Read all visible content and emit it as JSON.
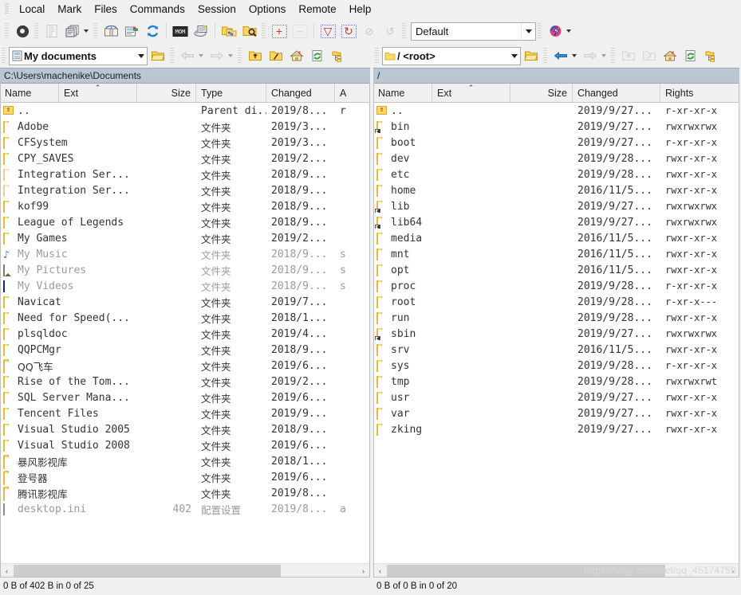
{
  "menu": {
    "items": [
      "Local",
      "Mark",
      "Files",
      "Commands",
      "Session",
      "Options",
      "Remote",
      "Help"
    ]
  },
  "toolbar": {
    "buttons": [
      {
        "name": "preferences",
        "icon": "gear-icon",
        "enabled": true
      },
      {
        "name": "session-properties",
        "icon": "document-properties-icon",
        "enabled": false
      },
      {
        "name": "duplicate-session",
        "icon": "copy-windows-icon",
        "enabled": true
      },
      {
        "name": "open-session",
        "icon": "open-session-icon",
        "enabled": true
      },
      {
        "name": "new-session",
        "icon": "new-session-icon",
        "enabled": true
      },
      {
        "name": "synchronize",
        "icon": "refresh-sync-icon",
        "enabled": true
      },
      {
        "name": "console",
        "icon": "console-icon",
        "enabled": true
      },
      {
        "name": "keep-remote-up-to-date",
        "icon": "keep-up-to-date-icon",
        "enabled": true
      },
      {
        "name": "synchronize-browsing",
        "icon": "sync-folders-icon",
        "enabled": true
      },
      {
        "name": "find-files",
        "icon": "find-files-icon",
        "enabled": true
      },
      {
        "name": "queue-add",
        "icon": "plus-icon",
        "enabled": true
      },
      {
        "name": "queue-remove",
        "icon": "minus-icon",
        "enabled": false
      },
      {
        "name": "filter",
        "icon": "funnel-icon",
        "enabled": true
      },
      {
        "name": "refresh",
        "icon": "refresh-icon",
        "enabled": true
      },
      {
        "name": "stop",
        "icon": "no-entry-icon",
        "enabled": false
      },
      {
        "name": "reconnect",
        "icon": "reload-circle-icon",
        "enabled": false
      }
    ],
    "preset": {
      "label": "Default",
      "name": "color-preset-combo"
    },
    "session_icon": {
      "name": "winscp-session-icon"
    }
  },
  "left_pane": {
    "nav": {
      "drive_label": "My documents",
      "drive_icon": "my-documents-icon",
      "open_dir_icon": "open-folder-icon",
      "back_enabled": false,
      "forward_enabled": false,
      "parent_icon": "parent-directory-icon",
      "root_icon": "root-directory-icon",
      "home_icon": "home-icon",
      "refresh_icon": "refresh-icon",
      "tree_icon": "directory-tree-icon"
    },
    "path": "C:\\Users\\machenike\\Documents",
    "columns": [
      {
        "label": "Name",
        "width": 74,
        "align": "left",
        "sorted": false
      },
      {
        "label": "Ext",
        "width": 98,
        "align": "left",
        "sorted": true
      },
      {
        "label": "Size",
        "width": 74,
        "align": "right",
        "sorted": false
      },
      {
        "label": "Type",
        "width": 88,
        "align": "left",
        "sorted": false
      },
      {
        "label": "Changed",
        "width": 86,
        "align": "left",
        "sorted": false
      },
      {
        "label": "A",
        "width": 40,
        "align": "left",
        "sorted": false
      }
    ],
    "rows": [
      {
        "icon": "parent-directory-icon",
        "name": "..",
        "ext": "",
        "size": "",
        "type": "Parent di...",
        "changed": "2019/8...",
        "attr": "r"
      },
      {
        "icon": "folder-icon",
        "name": "Adobe",
        "ext": "",
        "size": "",
        "type": "文件夹",
        "changed": "2019/3...",
        "attr": ""
      },
      {
        "icon": "folder-icon",
        "name": "CFSystem",
        "ext": "",
        "size": "",
        "type": "文件夹",
        "changed": "2019/3...",
        "attr": ""
      },
      {
        "icon": "folder-icon",
        "name": "CPY_SAVES",
        "ext": "",
        "size": "",
        "type": "文件夹",
        "changed": "2019/2...",
        "attr": ""
      },
      {
        "icon": "folder-icon-pale",
        "name": "Integration Ser...",
        "ext": "",
        "size": "",
        "type": "文件夹",
        "changed": "2018/9...",
        "attr": ""
      },
      {
        "icon": "folder-icon-pale",
        "name": "Integration Ser...",
        "ext": "",
        "size": "",
        "type": "文件夹",
        "changed": "2018/9...",
        "attr": ""
      },
      {
        "icon": "folder-icon",
        "name": "kof99",
        "ext": "",
        "size": "",
        "type": "文件夹",
        "changed": "2018/9...",
        "attr": ""
      },
      {
        "icon": "folder-icon",
        "name": "League of Legends",
        "ext": "",
        "size": "",
        "type": "文件夹",
        "changed": "2018/9...",
        "attr": ""
      },
      {
        "icon": "folder-icon",
        "name": "My Games",
        "ext": "",
        "size": "",
        "type": "文件夹",
        "changed": "2019/2...",
        "attr": ""
      },
      {
        "icon": "music-folder-icon",
        "name": "My Music",
        "ext": "",
        "size": "",
        "type": "文件夹",
        "changed": "2018/9...",
        "attr": "s",
        "dim": true
      },
      {
        "icon": "pictures-folder-icon",
        "name": "My Pictures",
        "ext": "",
        "size": "",
        "type": "文件夹",
        "changed": "2018/9...",
        "attr": "s",
        "dim": true
      },
      {
        "icon": "videos-folder-icon",
        "name": "My Videos",
        "ext": "",
        "size": "",
        "type": "文件夹",
        "changed": "2018/9...",
        "attr": "s",
        "dim": true
      },
      {
        "icon": "folder-icon",
        "name": "Navicat",
        "ext": "",
        "size": "",
        "type": "文件夹",
        "changed": "2019/7...",
        "attr": ""
      },
      {
        "icon": "folder-icon",
        "name": "Need for Speed(...",
        "ext": "",
        "size": "",
        "type": "文件夹",
        "changed": "2018/1...",
        "attr": ""
      },
      {
        "icon": "folder-icon",
        "name": "plsqldoc",
        "ext": "",
        "size": "",
        "type": "文件夹",
        "changed": "2019/4...",
        "attr": ""
      },
      {
        "icon": "folder-icon",
        "name": "QQPCMgr",
        "ext": "",
        "size": "",
        "type": "文件夹",
        "changed": "2018/9...",
        "attr": ""
      },
      {
        "icon": "folder-icon",
        "name": "QQ飞车",
        "ext": "",
        "size": "",
        "type": "文件夹",
        "changed": "2019/6...",
        "attr": ""
      },
      {
        "icon": "folder-icon",
        "name": "Rise of the Tom...",
        "ext": "",
        "size": "",
        "type": "文件夹",
        "changed": "2019/2...",
        "attr": ""
      },
      {
        "icon": "folder-icon",
        "name": "SQL Server Mana...",
        "ext": "",
        "size": "",
        "type": "文件夹",
        "changed": "2019/6...",
        "attr": ""
      },
      {
        "icon": "folder-icon",
        "name": "Tencent Files",
        "ext": "",
        "size": "",
        "type": "文件夹",
        "changed": "2019/9...",
        "attr": ""
      },
      {
        "icon": "folder-icon",
        "name": "Visual Studio 2005",
        "ext": "",
        "size": "",
        "type": "文件夹",
        "changed": "2018/9...",
        "attr": ""
      },
      {
        "icon": "folder-icon",
        "name": "Visual Studio 2008",
        "ext": "",
        "size": "",
        "type": "文件夹",
        "changed": "2019/6...",
        "attr": ""
      },
      {
        "icon": "folder-icon",
        "name": "暴风影视库",
        "ext": "",
        "size": "",
        "type": "文件夹",
        "changed": "2018/1...",
        "attr": ""
      },
      {
        "icon": "folder-icon",
        "name": "登号器",
        "ext": "",
        "size": "",
        "type": "文件夹",
        "changed": "2019/6...",
        "attr": ""
      },
      {
        "icon": "folder-icon",
        "name": "腾讯影视库",
        "ext": "",
        "size": "",
        "type": "文件夹",
        "changed": "2019/8...",
        "attr": ""
      },
      {
        "icon": "ini-file-icon",
        "name": "desktop.ini",
        "ext": "",
        "size": "402",
        "type": "配置设置",
        "changed": "2019/8...",
        "attr": "a",
        "dim": true
      }
    ],
    "scrollbar": {
      "left_arrow": "‹",
      "right_arrow": "›",
      "thumb_pct": 78
    },
    "status": "0 B of 402 B in 0 of 25"
  },
  "right_pane": {
    "nav": {
      "drive_label": "/ <root>",
      "drive_icon": "folder-icon",
      "open_dir_icon": "open-folder-icon",
      "back_enabled": true,
      "forward_enabled": false,
      "parent_icon": "parent-directory-icon",
      "root_icon": "root-directory-icon",
      "home_icon": "home-icon",
      "refresh_icon": "refresh-icon",
      "tree_icon": "directory-tree-icon"
    },
    "path": "/",
    "columns": [
      {
        "label": "Name",
        "width": 74,
        "align": "left",
        "sorted": false
      },
      {
        "label": "Ext",
        "width": 98,
        "align": "left",
        "sorted": true
      },
      {
        "label": "Size",
        "width": 78,
        "align": "right",
        "sorted": false
      },
      {
        "label": "Changed",
        "width": 110,
        "align": "left",
        "sorted": false
      },
      {
        "label": "Rights",
        "width": 99,
        "align": "left",
        "sorted": false
      }
    ],
    "rows": [
      {
        "icon": "parent-directory-icon",
        "name": "..",
        "size": "",
        "changed": "2019/9/27...",
        "rights": "r-xr-xr-x"
      },
      {
        "icon": "symlink-folder-icon",
        "name": "bin",
        "size": "",
        "changed": "2019/9/27...",
        "rights": "rwxrwxrwx"
      },
      {
        "icon": "folder-icon",
        "name": "boot",
        "size": "",
        "changed": "2019/9/27...",
        "rights": "r-xr-xr-x"
      },
      {
        "icon": "folder-icon",
        "name": "dev",
        "size": "",
        "changed": "2019/9/28...",
        "rights": "rwxr-xr-x"
      },
      {
        "icon": "folder-icon",
        "name": "etc",
        "size": "",
        "changed": "2019/9/28...",
        "rights": "rwxr-xr-x"
      },
      {
        "icon": "folder-icon",
        "name": "home",
        "size": "",
        "changed": "2016/11/5...",
        "rights": "rwxr-xr-x"
      },
      {
        "icon": "symlink-folder-icon",
        "name": "lib",
        "size": "",
        "changed": "2019/9/27...",
        "rights": "rwxrwxrwx"
      },
      {
        "icon": "symlink-folder-icon",
        "name": "lib64",
        "size": "",
        "changed": "2019/9/27...",
        "rights": "rwxrwxrwx"
      },
      {
        "icon": "folder-icon",
        "name": "media",
        "size": "",
        "changed": "2016/11/5...",
        "rights": "rwxr-xr-x"
      },
      {
        "icon": "folder-icon",
        "name": "mnt",
        "size": "",
        "changed": "2016/11/5...",
        "rights": "rwxr-xr-x"
      },
      {
        "icon": "folder-icon",
        "name": "opt",
        "size": "",
        "changed": "2016/11/5...",
        "rights": "rwxr-xr-x"
      },
      {
        "icon": "folder-icon",
        "name": "proc",
        "size": "",
        "changed": "2019/9/28...",
        "rights": "r-xr-xr-x"
      },
      {
        "icon": "folder-icon",
        "name": "root",
        "size": "",
        "changed": "2019/9/28...",
        "rights": "r-xr-x---"
      },
      {
        "icon": "folder-icon",
        "name": "run",
        "size": "",
        "changed": "2019/9/28...",
        "rights": "rwxr-xr-x"
      },
      {
        "icon": "symlink-folder-icon",
        "name": "sbin",
        "size": "",
        "changed": "2019/9/27...",
        "rights": "rwxrwxrwx"
      },
      {
        "icon": "folder-icon",
        "name": "srv",
        "size": "",
        "changed": "2016/11/5...",
        "rights": "rwxr-xr-x"
      },
      {
        "icon": "folder-icon",
        "name": "sys",
        "size": "",
        "changed": "2019/9/28...",
        "rights": "r-xr-xr-x"
      },
      {
        "icon": "folder-icon",
        "name": "tmp",
        "size": "",
        "changed": "2019/9/28...",
        "rights": "rwxrwxrwt"
      },
      {
        "icon": "folder-icon",
        "name": "usr",
        "size": "",
        "changed": "2019/9/27...",
        "rights": "rwxr-xr-x"
      },
      {
        "icon": "folder-icon",
        "name": "var",
        "size": "",
        "changed": "2019/9/27...",
        "rights": "rwxr-xr-x"
      },
      {
        "icon": "folder-icon",
        "name": "zking",
        "size": "",
        "changed": "2019/9/27...",
        "rights": "rwxr-xr-x"
      }
    ],
    "scrollbar": {
      "left_arrow": "‹",
      "right_arrow": "›",
      "thumb_pct": 82
    },
    "status": "0 B of 0 B in 0 of 20"
  },
  "watermark": "https://blog.csdn.net/qq_45174759",
  "colors": {
    "window_bg": "#f0f0f0",
    "pane_bg": "#ffffff",
    "path_bar_bg": "#b9c6d4",
    "folder_yellow": "#ffd866",
    "accent_blue": "#2a7fd4"
  }
}
